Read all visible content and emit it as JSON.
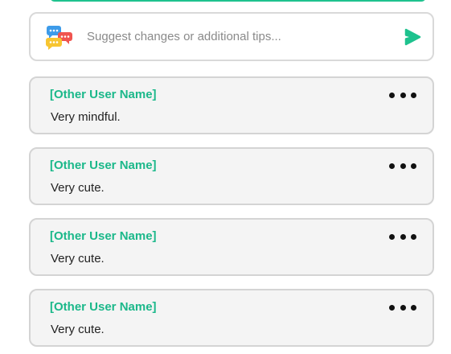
{
  "composer": {
    "placeholder": "Suggest changes or additional tips...",
    "value": ""
  },
  "comments": [
    {
      "author": "[Other User Name]",
      "text": "Very mindful."
    },
    {
      "author": "[Other User Name]",
      "text": "Very cute."
    },
    {
      "author": "[Other User Name]",
      "text": "Very cute."
    },
    {
      "author": "[Other User Name]",
      "text": "Very cute."
    }
  ],
  "colors": {
    "accent": "#1ec28e",
    "author": "#1bb88a",
    "card_bg": "#f4f4f4",
    "card_border": "#d4d4d4"
  },
  "icons": {
    "composer_icon": "chat-bubbles-icon",
    "send_icon": "send-arrow-icon",
    "more_icon": "more-options-icon"
  }
}
